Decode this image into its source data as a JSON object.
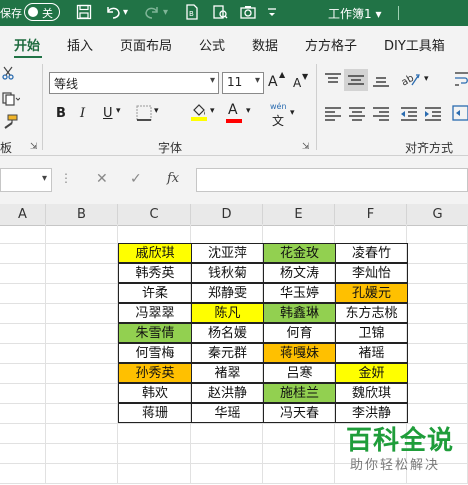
{
  "titlebar": {
    "autosave_label": "保存",
    "toggle_state": "关",
    "title": "工作簿1",
    "title_dropdown": "▾",
    "save_icon": "save-icon",
    "undo_icon": "undo-icon",
    "redo_icon": "redo-icon"
  },
  "tabs": [
    "开始",
    "插入",
    "页面布局",
    "公式",
    "数据",
    "方方格子",
    "DIY工具箱"
  ],
  "ribbon": {
    "font_name": "等线",
    "font_size": "11",
    "bold": "B",
    "italic": "I",
    "underline": "U",
    "font_color_letter": "A",
    "grow_font": "A",
    "shrink_font": "A",
    "wen": "wén",
    "wen_char": "文",
    "font_group_label": "字体",
    "align_group_label": "对齐方式",
    "left_group_label": "板",
    "colors": {
      "highlight": "#ffff00",
      "font_color": "#ff0000"
    }
  },
  "formula_bar": {
    "cancel": "✕",
    "confirm": "✓",
    "fx": "fx",
    "name_value": "",
    "formula_value": ""
  },
  "columns": [
    "A",
    "B",
    "C",
    "D",
    "E",
    "F",
    "G"
  ],
  "table": {
    "rows": [
      [
        {
          "t": "戚欣琪",
          "f": "yellow"
        },
        {
          "t": "沈亚萍",
          "f": ""
        },
        {
          "t": "花金玫",
          "f": "green"
        },
        {
          "t": "凌春竹",
          "f": ""
        }
      ],
      [
        {
          "t": "韩秀英",
          "f": ""
        },
        {
          "t": "钱秋菊",
          "f": ""
        },
        {
          "t": "杨文涛",
          "f": ""
        },
        {
          "t": "李灿怡",
          "f": ""
        }
      ],
      [
        {
          "t": "许柔",
          "f": ""
        },
        {
          "t": "郑静雯",
          "f": ""
        },
        {
          "t": "华玉婷",
          "f": ""
        },
        {
          "t": "孔媛元",
          "f": "orange"
        }
      ],
      [
        {
          "t": "冯翠翠",
          "f": ""
        },
        {
          "t": "陈凡",
          "f": "yellow"
        },
        {
          "t": "韩鑫琳",
          "f": "green"
        },
        {
          "t": "东方志桃",
          "f": ""
        }
      ],
      [
        {
          "t": "朱雪倩",
          "f": "green"
        },
        {
          "t": "杨名媛",
          "f": ""
        },
        {
          "t": "何育",
          "f": ""
        },
        {
          "t": "卫锦",
          "f": ""
        }
      ],
      [
        {
          "t": "何雪梅",
          "f": ""
        },
        {
          "t": "秦元群",
          "f": ""
        },
        {
          "t": "蒋嘎妹",
          "f": "orange"
        },
        {
          "t": "褚瑶",
          "f": ""
        }
      ],
      [
        {
          "t": "孙秀英",
          "f": "orange"
        },
        {
          "t": "褚翠",
          "f": ""
        },
        {
          "t": "吕寒",
          "f": ""
        },
        {
          "t": "金妍",
          "f": "yellow"
        }
      ],
      [
        {
          "t": "韩欢",
          "f": ""
        },
        {
          "t": "赵洪静",
          "f": ""
        },
        {
          "t": "施桂兰",
          "f": "green"
        },
        {
          "t": "魏欣琪",
          "f": ""
        }
      ],
      [
        {
          "t": "蒋珊",
          "f": ""
        },
        {
          "t": "华瑶",
          "f": ""
        },
        {
          "t": "冯天春",
          "f": ""
        },
        {
          "t": "李洪静",
          "f": ""
        }
      ]
    ]
  },
  "watermark": {
    "title": "百科全说",
    "subtitle": "助你轻松解决"
  }
}
